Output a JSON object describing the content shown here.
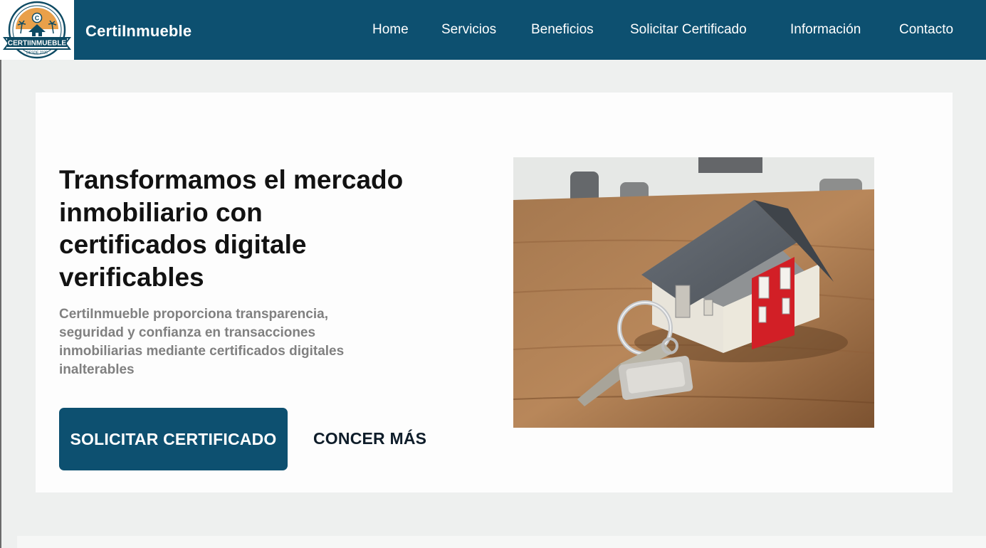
{
  "header": {
    "logo": {
      "icon": "certiinmueble-logo",
      "badge_text": "CERTIINMUEBLE",
      "since_text": "DESDE 2025",
      "letter": "C"
    },
    "brand": "CertiInmueble",
    "nav": [
      {
        "label": "Home"
      },
      {
        "label": "Servicios"
      },
      {
        "label": "Beneficios"
      },
      {
        "label": "Solicitar Certificado"
      },
      {
        "label": "Información"
      },
      {
        "label": "Contacto"
      }
    ]
  },
  "hero": {
    "title": "Transformamos el mercado inmobiliario con certificados digitale verificables",
    "description": "CertiInmueble proporciona transparencia, seguridad y confianza en transacciones inmobiliarias mediante certificados digitales inalterables",
    "primary_button": "SOLICITAR CERTIFICADO",
    "secondary_button": "CONCER MÁS",
    "image": "house-model-with-keys-photo"
  },
  "colors": {
    "brand": "#0d5070",
    "background": "#eef0ef",
    "card": "#fdfdfd",
    "logo_orange": "#e9a04a"
  }
}
